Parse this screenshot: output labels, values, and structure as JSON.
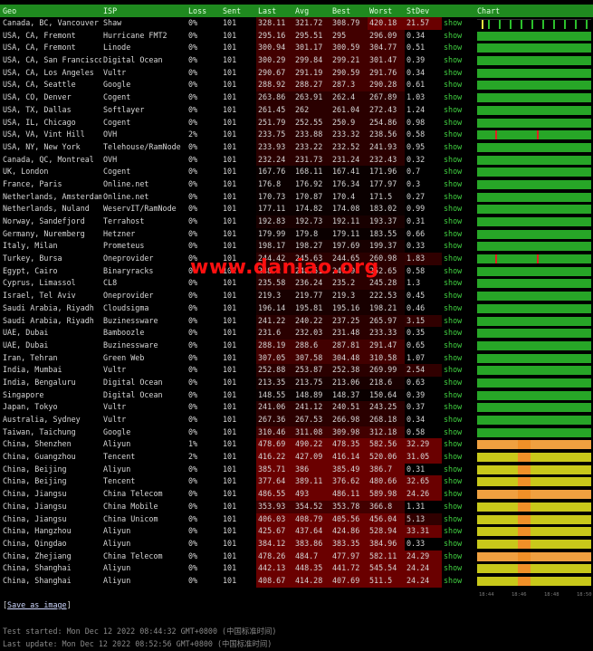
{
  "headers": [
    "Geo",
    "ISP",
    "Loss",
    "Sent",
    "Last",
    "Avg",
    "Best",
    "Worst",
    "StDev",
    "",
    "Chart"
  ],
  "show_label": "show",
  "colors": {
    "header_bg": "#1f8a1f",
    "green_bar": "#27a627",
    "yellow_bar": "#c8c81a",
    "orange_bar": "#f0a040",
    "latency_cell": "#6e0000",
    "spike": "#e02020"
  },
  "rows": [
    [
      "Canada, BC, Vancouver",
      "Shaw",
      "0%",
      "101",
      "328.11",
      "321.72",
      "308.79",
      "420.18",
      "21.57",
      "black"
    ],
    [
      "USA, CA, Fremont",
      "Hurricane FMT2",
      "0%",
      "101",
      "295.16",
      "295.51",
      "295",
      "296.09",
      "0.34",
      "green"
    ],
    [
      "USA, CA, Fremont",
      "Linode",
      "0%",
      "101",
      "300.94",
      "301.17",
      "300.59",
      "304.77",
      "0.51",
      "green"
    ],
    [
      "USA, CA, San Francisco",
      "Digital Ocean",
      "0%",
      "101",
      "300.29",
      "299.84",
      "299.21",
      "301.47",
      "0.39",
      "green"
    ],
    [
      "USA, CA, Los Angeles",
      "Vultr",
      "0%",
      "101",
      "290.67",
      "291.19",
      "290.59",
      "291.76",
      "0.34",
      "green"
    ],
    [
      "USA, CA, Seattle",
      "Google",
      "0%",
      "101",
      "288.92",
      "288.27",
      "287.3",
      "290.28",
      "0.61",
      "green"
    ],
    [
      "USA, CO, Denver",
      "Cogent",
      "0%",
      "101",
      "263.86",
      "263.91",
      "262.4",
      "267.89",
      "1.03",
      "green"
    ],
    [
      "USA, TX, Dallas",
      "Softlayer",
      "0%",
      "101",
      "261.45",
      "262",
      "261.04",
      "272.43",
      "1.24",
      "green"
    ],
    [
      "USA, IL, Chicago",
      "Cogent",
      "0%",
      "101",
      "251.79",
      "252.55",
      "250.9",
      "254.86",
      "0.98",
      "green"
    ],
    [
      "USA, VA, Vint Hill",
      "OVH",
      "2%",
      "101",
      "233.75",
      "233.88",
      "233.32",
      "238.56",
      "0.58",
      "green"
    ],
    [
      "USA, NY, New York",
      "Telehouse/RamNode",
      "0%",
      "101",
      "233.93",
      "233.22",
      "232.52",
      "241.93",
      "0.95",
      "green"
    ],
    [
      "Canada, QC, Montreal",
      "OVH",
      "0%",
      "101",
      "232.24",
      "231.73",
      "231.24",
      "232.43",
      "0.32",
      "green"
    ],
    [
      "UK, London",
      "Cogent",
      "0%",
      "101",
      "167.76",
      "168.11",
      "167.41",
      "171.96",
      "0.7",
      "green"
    ],
    [
      "France, Paris",
      "Online.net",
      "0%",
      "101",
      "176.8",
      "176.92",
      "176.34",
      "177.97",
      "0.3",
      "green"
    ],
    [
      "Netherlands, Amsterdam",
      "Online.net",
      "0%",
      "101",
      "170.73",
      "170.87",
      "170.4",
      "171.5",
      "0.27",
      "green"
    ],
    [
      "Netherlands, Nuland",
      "WeservIT/RamNode",
      "0%",
      "101",
      "177.11",
      "174.82",
      "174.08",
      "183.02",
      "0.99",
      "green"
    ],
    [
      "Norway, Sandefjord",
      "Terrahost",
      "0%",
      "101",
      "192.83",
      "192.73",
      "192.11",
      "193.37",
      "0.31",
      "green"
    ],
    [
      "Germany, Nuremberg",
      "Hetzner",
      "0%",
      "101",
      "179.99",
      "179.8",
      "179.11",
      "183.55",
      "0.66",
      "green"
    ],
    [
      "Italy, Milan",
      "Prometeus",
      "0%",
      "101",
      "198.17",
      "198.27",
      "197.69",
      "199.37",
      "0.33",
      "green"
    ],
    [
      "Turkey, Bursa",
      "Oneprovider",
      "0%",
      "101",
      "244.42",
      "245.63",
      "244.65",
      "260.98",
      "1.83",
      "green"
    ],
    [
      "Egypt, Cairo",
      "Binaryracks",
      "0%",
      "101",
      "248.2",
      "248.51",
      "247.98",
      "252.65",
      "0.58",
      "green"
    ],
    [
      "Cyprus, Limassol",
      "CL8",
      "0%",
      "101",
      "235.58",
      "236.24",
      "235.2",
      "245.28",
      "1.3",
      "green"
    ],
    [
      "Israel, Tel Aviv",
      "Oneprovider",
      "0%",
      "101",
      "219.3",
      "219.77",
      "219.3",
      "222.53",
      "0.45",
      "green"
    ],
    [
      "Saudi Arabia, Riyadh",
      "Cloudsigma",
      "0%",
      "101",
      "196.14",
      "195.81",
      "195.16",
      "198.21",
      "0.46",
      "green"
    ],
    [
      "Saudi Arabia, Riyadh",
      "Buzinessware",
      "0%",
      "101",
      "241.22",
      "240.22",
      "237.25",
      "265.97",
      "3.15",
      "green"
    ],
    [
      "UAE, Dubai",
      "Bamboozle",
      "0%",
      "101",
      "231.6",
      "232.03",
      "231.48",
      "233.33",
      "0.35",
      "green"
    ],
    [
      "UAE, Dubai",
      "Buzinessware",
      "0%",
      "101",
      "288.19",
      "288.6",
      "287.81",
      "291.47",
      "0.65",
      "green"
    ],
    [
      "Iran, Tehran",
      "Green Web",
      "0%",
      "101",
      "307.05",
      "307.58",
      "304.48",
      "310.58",
      "1.07",
      "green"
    ],
    [
      "India, Mumbai",
      "Vultr",
      "0%",
      "101",
      "252.88",
      "253.87",
      "252.38",
      "269.99",
      "2.54",
      "green"
    ],
    [
      "India, Bengaluru",
      "Digital Ocean",
      "0%",
      "101",
      "213.35",
      "213.75",
      "213.06",
      "218.6",
      "0.63",
      "green"
    ],
    [
      "Singapore",
      "Digital Ocean",
      "0%",
      "101",
      "148.55",
      "148.89",
      "148.37",
      "150.64",
      "0.39",
      "green"
    ],
    [
      "Japan, Tokyo",
      "Vultr",
      "0%",
      "101",
      "241.06",
      "241.12",
      "240.51",
      "243.25",
      "0.37",
      "green"
    ],
    [
      "Australia, Sydney",
      "Vultr",
      "0%",
      "101",
      "267.36",
      "267.53",
      "266.98",
      "268.18",
      "0.34",
      "green"
    ],
    [
      "Taiwan, Taichung",
      "Google",
      "0%",
      "101",
      "310.46",
      "311.08",
      "309.98",
      "312.18",
      "0.58",
      "green"
    ],
    [
      "China, Shenzhen",
      "Aliyun",
      "1%",
      "101",
      "478.69",
      "490.22",
      "478.35",
      "582.56",
      "32.29",
      "orange"
    ],
    [
      "China, Guangzhou",
      "Tencent",
      "2%",
      "101",
      "416.22",
      "427.09",
      "416.14",
      "520.06",
      "31.05",
      "yellow"
    ],
    [
      "China, Beijing",
      "Aliyun",
      "0%",
      "101",
      "385.71",
      "386",
      "385.49",
      "386.7",
      "0.31",
      "yellow"
    ],
    [
      "China, Beijing",
      "Tencent",
      "0%",
      "101",
      "377.64",
      "389.11",
      "376.62",
      "480.66",
      "32.65",
      "yellow"
    ],
    [
      "China, Jiangsu",
      "China Telecom",
      "0%",
      "101",
      "486.55",
      "493",
      "486.11",
      "589.98",
      "24.26",
      "orange"
    ],
    [
      "China, Jiangsu",
      "China Mobile",
      "0%",
      "101",
      "353.93",
      "354.52",
      "353.78",
      "366.8",
      "1.31",
      "yellow"
    ],
    [
      "China, Jiangsu",
      "China Unicom",
      "0%",
      "101",
      "406.03",
      "408.79",
      "405.56",
      "456.04",
      "5.13",
      "yellow"
    ],
    [
      "China, Hangzhou",
      "Aliyun",
      "0%",
      "101",
      "425.67",
      "437.64",
      "424.86",
      "528.94",
      "33.31",
      "yellow"
    ],
    [
      "China, Qingdao",
      "Aliyun",
      "0%",
      "101",
      "384.12",
      "383.86",
      "383.35",
      "384.96",
      "0.33",
      "yellow"
    ],
    [
      "China, Zhejiang",
      "China Telecom",
      "0%",
      "101",
      "478.26",
      "484.7",
      "477.97",
      "582.11",
      "24.29",
      "orange"
    ],
    [
      "China, Shanghai",
      "Aliyun",
      "0%",
      "101",
      "442.13",
      "448.35",
      "441.72",
      "545.54",
      "24.24",
      "yellow"
    ],
    [
      "China, Shanghai",
      "Aliyun",
      "0%",
      "101",
      "408.67",
      "414.28",
      "407.69",
      "511.5",
      "24.24",
      "yellow"
    ]
  ],
  "axis_labels": [
    "18:44",
    "18:46",
    "18:48",
    "18:50"
  ],
  "save_link": "Save as image",
  "footer": {
    "started": "Test started: Mon Dec 12 2022 08:44:32 GMT+0800 (中国标准时间)",
    "updated": "Last update: Mon Dec 12 2022 08:52:56 GMT+0800 (中国标准时间)"
  },
  "watermark": "www.daniao.org"
}
